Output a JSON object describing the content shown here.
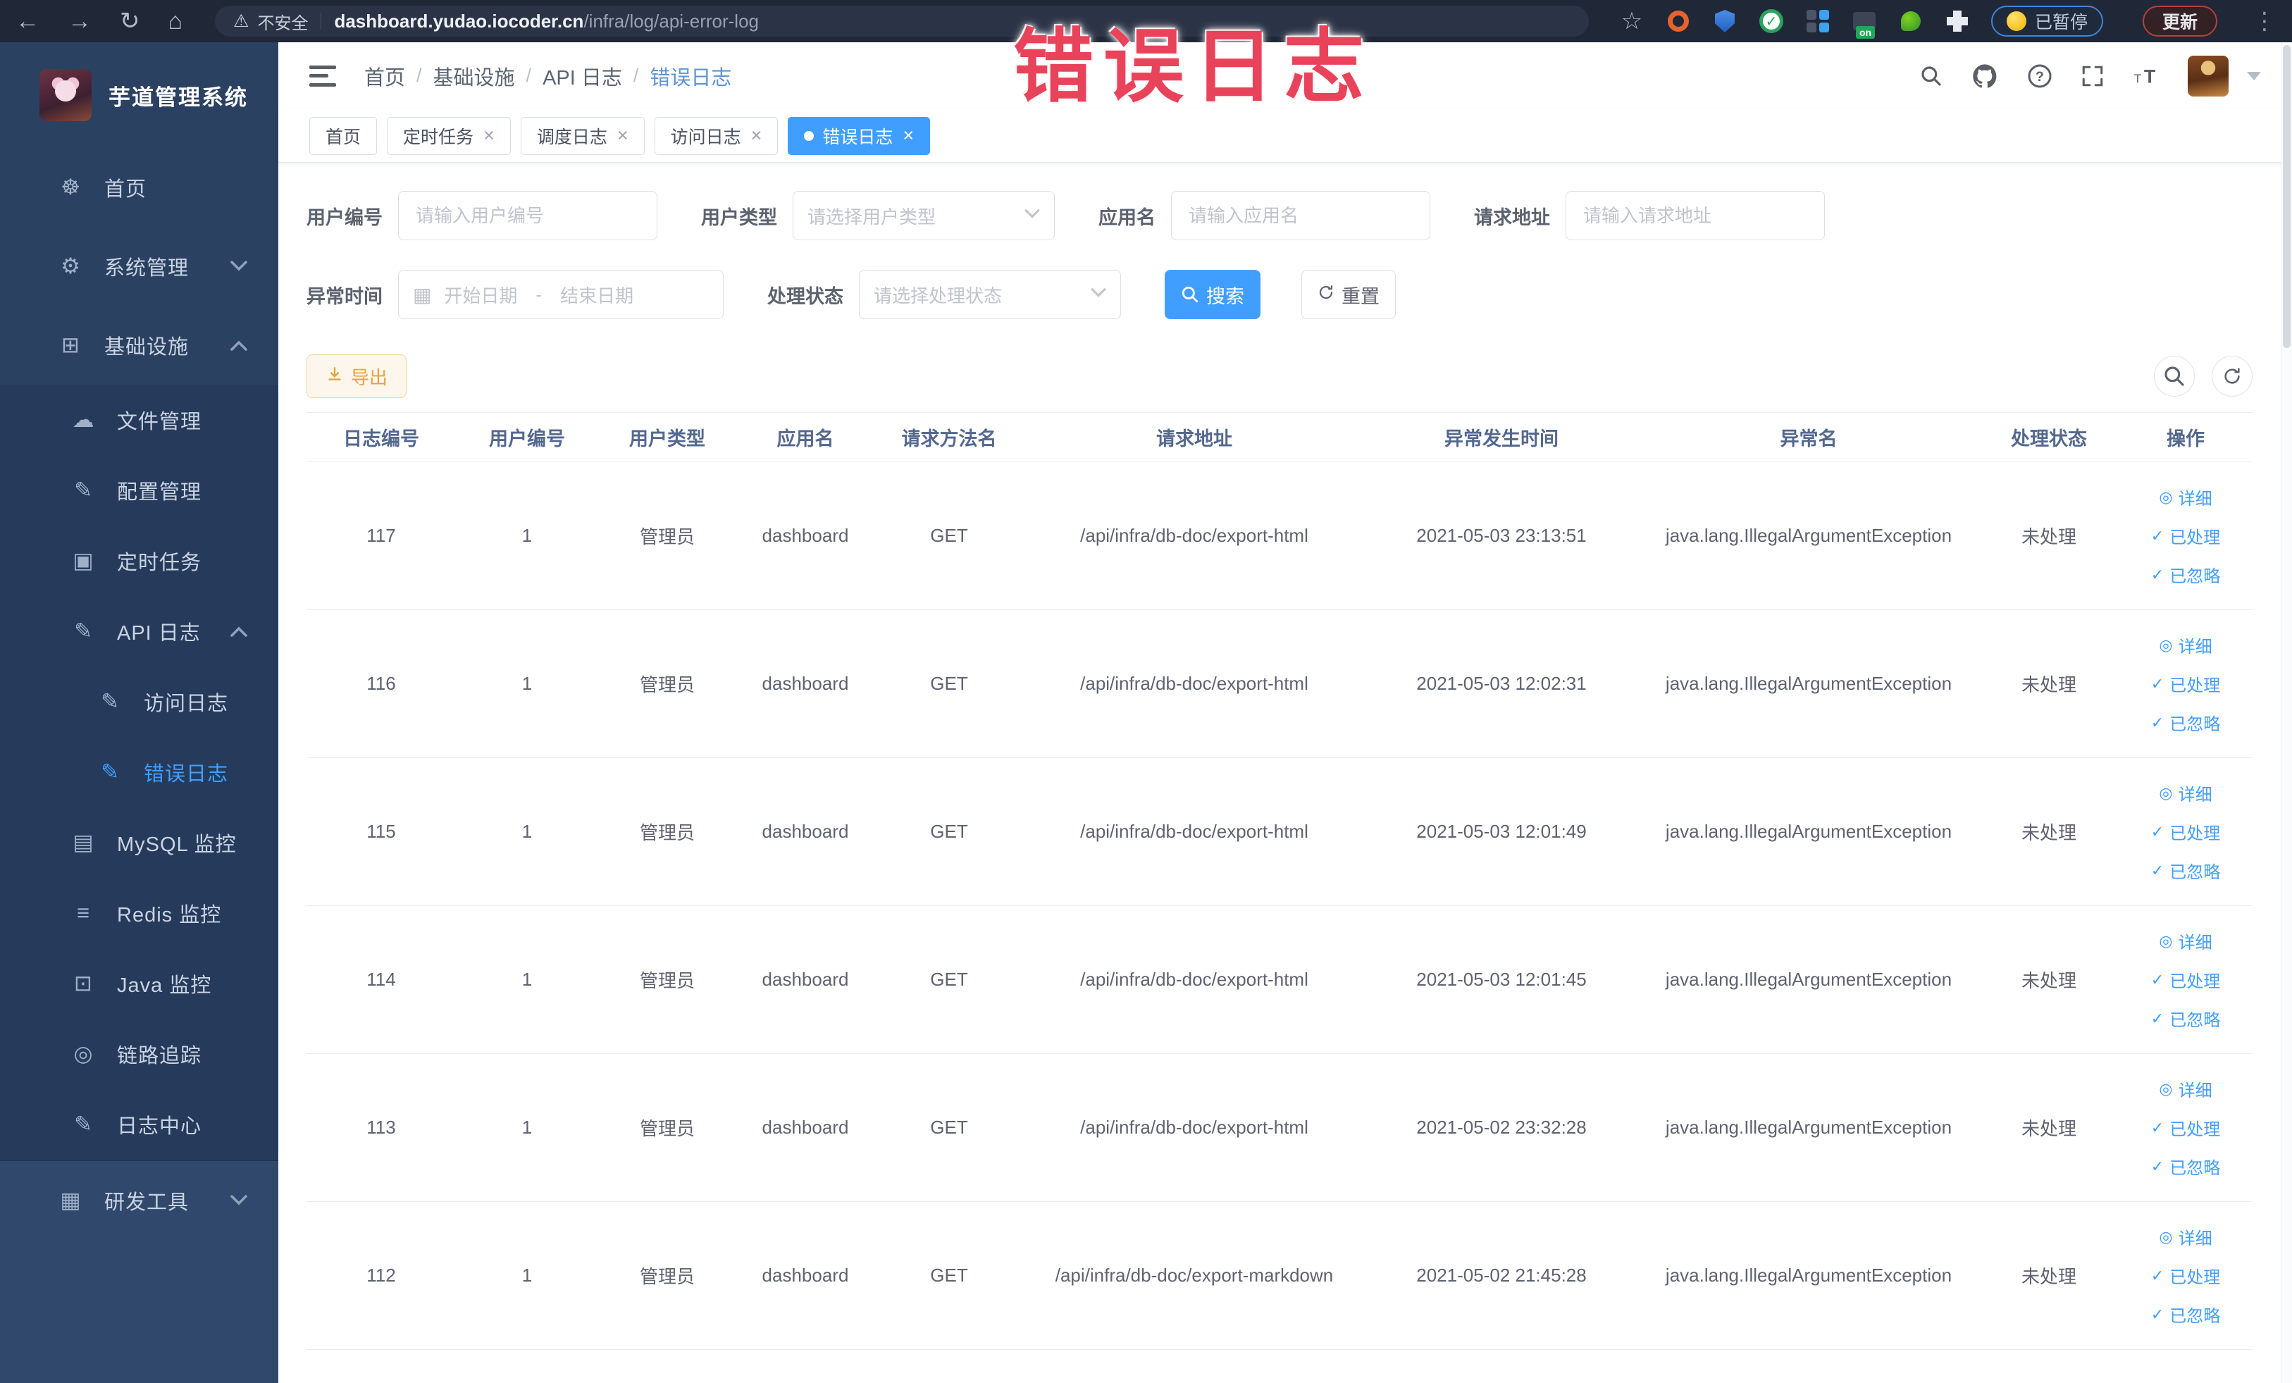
{
  "colors": {
    "accent": "#409eff",
    "warning": "#e6a23c",
    "annotation_red": "#e8435a",
    "sidebar_bg": "#2b4162",
    "chrome_bg": "#202737"
  },
  "annotation": {
    "text": "错误日志"
  },
  "browser": {
    "security_label": "不安全",
    "url_host": "dashboard.yudao.iocoder.cn",
    "url_path": "/infra/log/api-error-log",
    "paused_badge": "已暂停",
    "update_button": "更新"
  },
  "sidebar": {
    "app_title": "芋道管理系统",
    "menu": [
      {
        "label": "首页",
        "icon": "paw",
        "level": 0,
        "section": "base"
      },
      {
        "label": "系统管理",
        "icon": "gear",
        "level": 0,
        "section": "base",
        "chevron": "down"
      },
      {
        "label": "基础设施",
        "icon": "monitor",
        "level": 0,
        "section": "base",
        "chevron": "up"
      },
      {
        "label": "文件管理",
        "icon": "cloud-upload",
        "level": 1,
        "section": "sub"
      },
      {
        "label": "配置管理",
        "icon": "edit",
        "level": 1,
        "section": "sub"
      },
      {
        "label": "定时任务",
        "icon": "timer",
        "level": 1,
        "section": "sub"
      },
      {
        "label": "API 日志",
        "icon": "edit-square",
        "level": 1,
        "section": "sub",
        "chevron": "up"
      },
      {
        "label": "访问日志",
        "icon": "edit",
        "level": 2,
        "section": "sub"
      },
      {
        "label": "错误日志",
        "icon": "edit",
        "level": 2,
        "section": "sub",
        "active": true
      },
      {
        "label": "MySQL 监控",
        "icon": "image",
        "level": 1,
        "section": "sub"
      },
      {
        "label": "Redis 监控",
        "icon": "layers",
        "level": 1,
        "section": "sub"
      },
      {
        "label": "Java 监控",
        "icon": "screen",
        "level": 1,
        "section": "sub"
      },
      {
        "label": "链路追踪",
        "icon": "eye",
        "level": 1,
        "section": "sub"
      },
      {
        "label": "日志中心",
        "icon": "edit",
        "level": 1,
        "section": "sub"
      },
      {
        "label": "研发工具",
        "icon": "toolbox",
        "level": 0,
        "section": "foot",
        "chevron": "down"
      }
    ]
  },
  "header": {
    "breadcrumb": [
      "首页",
      "基础设施",
      "API 日志",
      "错误日志"
    ]
  },
  "tabs": [
    {
      "label": "首页",
      "closable": false,
      "active": false
    },
    {
      "label": "定时任务",
      "closable": true,
      "active": false
    },
    {
      "label": "调度日志",
      "closable": true,
      "active": false
    },
    {
      "label": "访问日志",
      "closable": true,
      "active": false
    },
    {
      "label": "错误日志",
      "closable": true,
      "active": true
    }
  ],
  "filters": {
    "fields_row1": [
      {
        "label": "用户编号",
        "type": "input",
        "placeholder": "请输入用户编号"
      },
      {
        "label": "用户类型",
        "type": "select",
        "placeholder": "请选择用户类型"
      },
      {
        "label": "应用名",
        "type": "input",
        "placeholder": "请输入应用名"
      },
      {
        "label": "请求地址",
        "type": "input",
        "placeholder": "请输入请求地址"
      }
    ],
    "fields_row2": [
      {
        "label": "异常时间",
        "type": "daterange",
        "start_placeholder": "开始日期",
        "separator": "-",
        "end_placeholder": "结束日期"
      },
      {
        "label": "处理状态",
        "type": "select",
        "placeholder": "请选择处理状态"
      }
    ],
    "search_label": "搜索",
    "reset_label": "重置"
  },
  "toolbar": {
    "export_label": "导出"
  },
  "table": {
    "columns": [
      "日志编号",
      "用户编号",
      "用户类型",
      "应用名",
      "请求方法名",
      "请求地址",
      "异常发生时间",
      "异常名",
      "处理状态",
      "操作"
    ],
    "row_actions": [
      {
        "label": "详细",
        "icon": "view"
      },
      {
        "label": "已处理",
        "icon": "check"
      },
      {
        "label": "已忽略",
        "icon": "check"
      }
    ],
    "rows": [
      {
        "id": "117",
        "user_id": "1",
        "user_type": "管理员",
        "app": "dashboard",
        "method": "GET",
        "url": "/api/infra/db-doc/export-html",
        "time": "2021-05-03 23:13:51",
        "exception": "java.lang.IllegalArgumentException",
        "status": "未处理"
      },
      {
        "id": "116",
        "user_id": "1",
        "user_type": "管理员",
        "app": "dashboard",
        "method": "GET",
        "url": "/api/infra/db-doc/export-html",
        "time": "2021-05-03 12:02:31",
        "exception": "java.lang.IllegalArgumentException",
        "status": "未处理"
      },
      {
        "id": "115",
        "user_id": "1",
        "user_type": "管理员",
        "app": "dashboard",
        "method": "GET",
        "url": "/api/infra/db-doc/export-html",
        "time": "2021-05-03 12:01:49",
        "exception": "java.lang.IllegalArgumentException",
        "status": "未处理"
      },
      {
        "id": "114",
        "user_id": "1",
        "user_type": "管理员",
        "app": "dashboard",
        "method": "GET",
        "url": "/api/infra/db-doc/export-html",
        "time": "2021-05-03 12:01:45",
        "exception": "java.lang.IllegalArgumentException",
        "status": "未处理"
      },
      {
        "id": "113",
        "user_id": "1",
        "user_type": "管理员",
        "app": "dashboard",
        "method": "GET",
        "url": "/api/infra/db-doc/export-html",
        "time": "2021-05-02 23:32:28",
        "exception": "java.lang.IllegalArgumentException",
        "status": "未处理"
      },
      {
        "id": "112",
        "user_id": "1",
        "user_type": "管理员",
        "app": "dashboard",
        "method": "GET",
        "url": "/api/infra/db-doc/export-markdown",
        "time": "2021-05-02 21:45:28",
        "exception": "java.lang.IllegalArgumentException",
        "status": "未处理"
      }
    ]
  }
}
